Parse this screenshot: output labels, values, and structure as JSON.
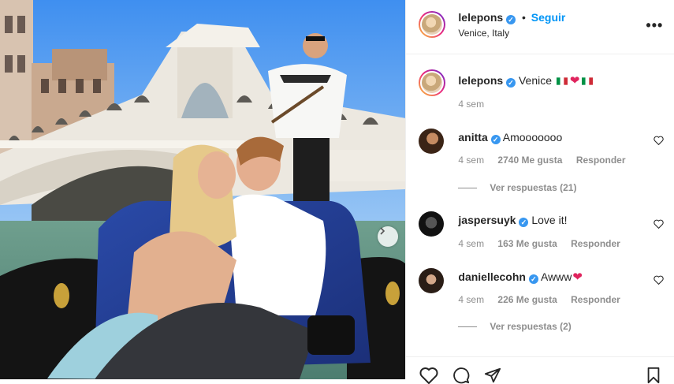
{
  "post": {
    "username": "lelepons",
    "follow_label": "Seguir",
    "location": "Venice, Italy",
    "more_label": "•••"
  },
  "caption": {
    "username": "lelepons",
    "text": "Venice",
    "time": "4 sem"
  },
  "comments": [
    {
      "username": "anitta",
      "text": "Amooooooo",
      "time": "4 sem",
      "likes": "2740 Me gusta",
      "reply": "Responder",
      "view_replies": "Ver respuestas (21)"
    },
    {
      "username": "jaspersuyk",
      "text": "Love it!",
      "time": "4 sem",
      "likes": "163 Me gusta",
      "reply": "Responder"
    },
    {
      "username": "daniellecohn",
      "text": "Awww",
      "time": "4 sem",
      "likes": "226 Me gusta",
      "reply": "Responder",
      "view_replies": "Ver respuestas (2)"
    }
  ],
  "colors": {
    "accent": "#0095f6",
    "verified": "#3897f0",
    "muted": "#8e8e8e",
    "heart": "#e0245e"
  },
  "icons": {
    "like": "heart-outline-icon",
    "comment": "speech-bubble-icon",
    "share": "paper-plane-icon",
    "save": "bookmark-icon",
    "next": "chevron-right-icon"
  }
}
